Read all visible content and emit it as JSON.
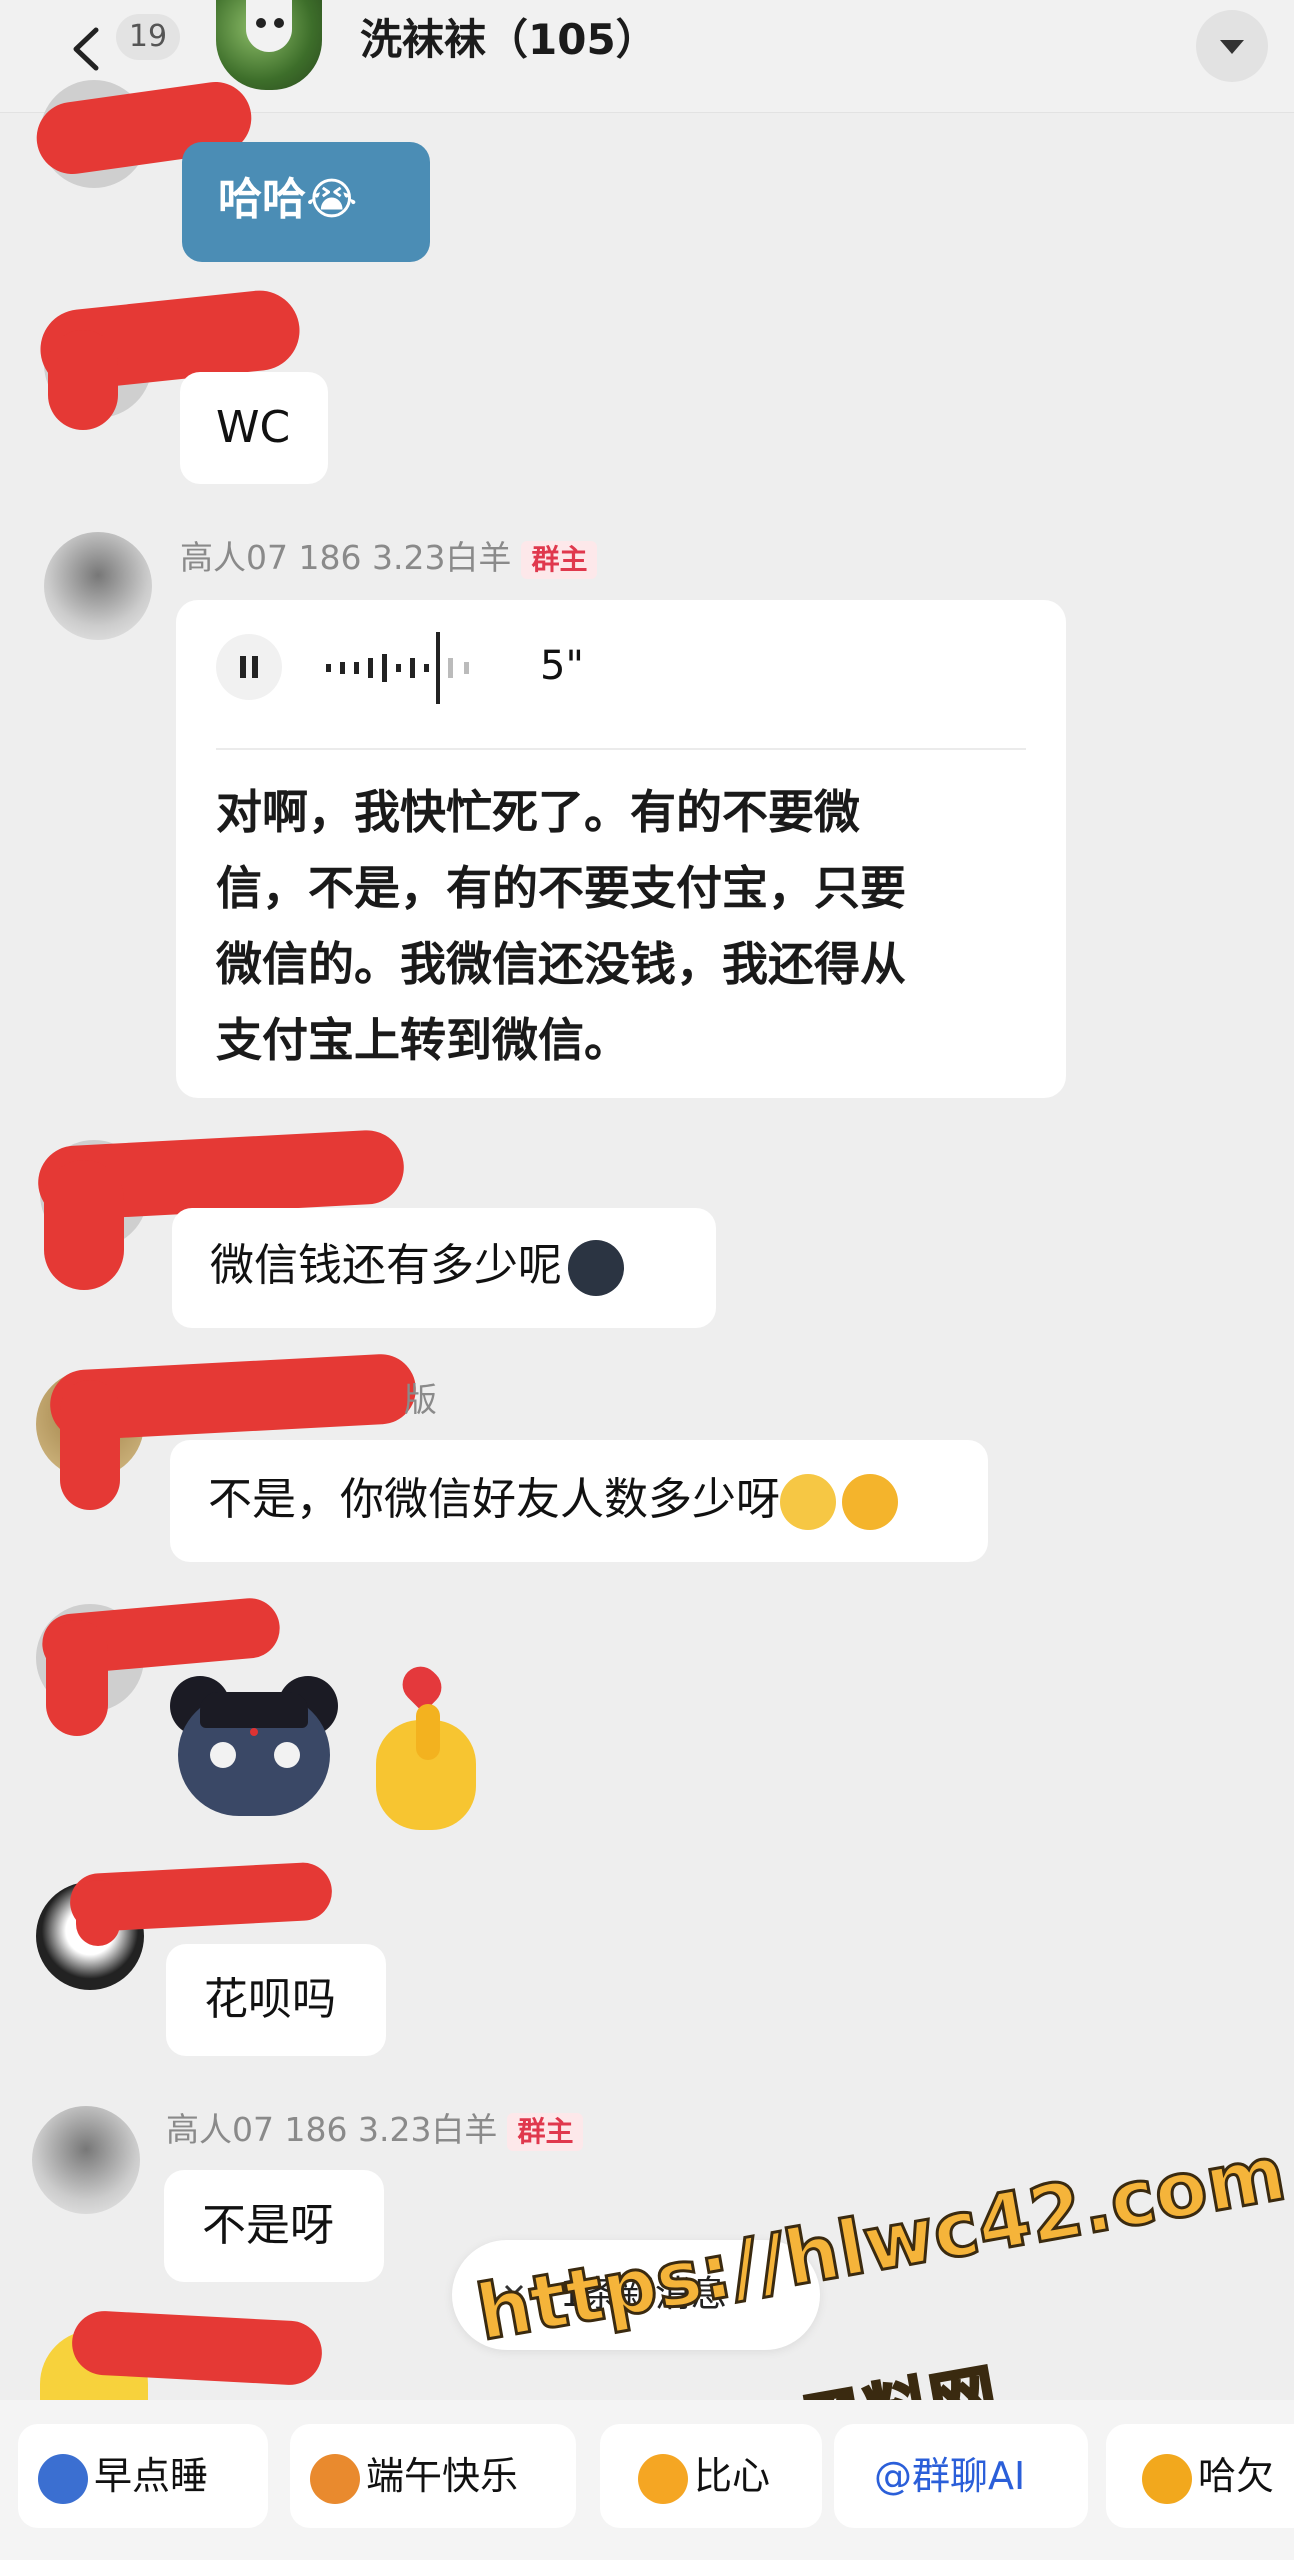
{
  "header": {
    "back_count": "19",
    "title": "洗袜袜（105）"
  },
  "messages": [
    {
      "text": "哈哈😭"
    },
    {
      "text": "WC"
    },
    {
      "sender": "高人07 186 3.23白羊",
      "role": "群主",
      "voice_duration": "5\"",
      "transcript": [
        "对啊，我快忙死了。有的不要微",
        "信，不是，有的不要支付宝，只要",
        "微信的。我微信还没钱，我还得从",
        "支付宝上转到微信。"
      ]
    },
    {
      "text": "微信钱还有多少呢"
    },
    {
      "sender_fragment": "版",
      "text": "不是，你微信好友人数多少呀"
    },
    {
      "stickers": [
        "monster-sticker",
        "finger-heart-sticker"
      ]
    },
    {
      "text": "花呗吗"
    },
    {
      "sender": "高人07 186 3.23白羊",
      "role": "群主",
      "text": "不是呀"
    }
  ],
  "new_message_pill": "1条新消息",
  "watermark": {
    "url": "https://hlwc42.com",
    "name": "黑料网"
  },
  "quick_replies": [
    {
      "label": "早点睡",
      "icon": "moon-icon"
    },
    {
      "label": "端午快乐",
      "icon": "dragon-icon"
    },
    {
      "label": "比心",
      "icon": "heart-hand-icon"
    },
    {
      "label": "@群聊AI",
      "icon": "at-icon"
    },
    {
      "label": "哈欠",
      "icon": "yawn-icon"
    }
  ],
  "colors": {
    "background": "#eeeeee",
    "bubble": "#ffffff",
    "blue_bubble": "#4b8db5",
    "redaction": "#e53935",
    "role_badge": "#e0384d",
    "watermark": "#f5b43a"
  }
}
